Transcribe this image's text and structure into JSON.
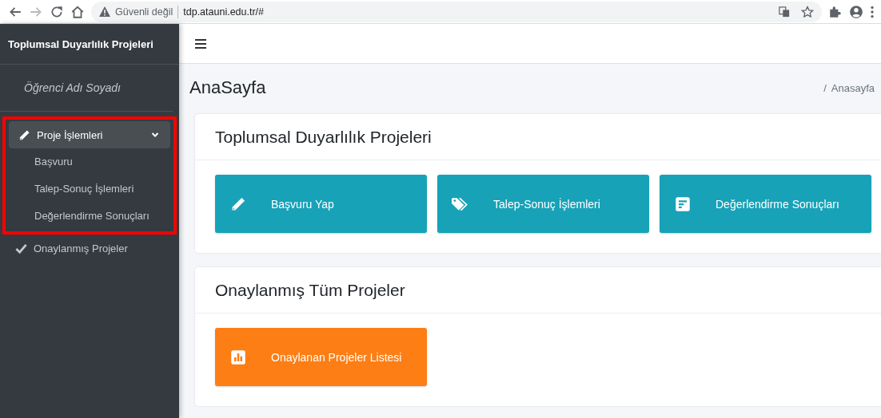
{
  "browser": {
    "warning": "Güvenli değil",
    "url": "tdp.atauni.edu.tr/#"
  },
  "sidebar": {
    "brand": "Toplumsal Duyarlılık Projeleri",
    "user": "Öğrenci Adı Soyadı",
    "highlighted": true,
    "items": [
      {
        "kind": "group",
        "label": "Proje İşlemleri",
        "expanded": true,
        "children": [
          {
            "label": "Başvuru"
          },
          {
            "label": "Talep-Sonuç İşlemleri"
          },
          {
            "label": "Değerlendirme Sonuçları"
          }
        ]
      },
      {
        "kind": "link",
        "label": "Onaylanmış Projeler"
      }
    ]
  },
  "page_title": "AnaSayfa",
  "breadcrumb": {
    "separator": "/",
    "current": "Anasayfa"
  },
  "sections": [
    {
      "title": "Toplumsal Duyarlılık Projeleri",
      "buttons": [
        {
          "label": "Başvuru Yap",
          "color": "#17a2b8"
        },
        {
          "label": "Talep-Sonuç İşlemleri",
          "color": "#17a2b8"
        },
        {
          "label": "Değerlendirme Sonuçları",
          "color": "#17a2b8"
        }
      ]
    },
    {
      "title": "Onaylanmış Tüm Projeler",
      "buttons": [
        {
          "label": "Onaylanan Projeler Listesi",
          "color": "#fd7e14"
        }
      ]
    }
  ]
}
